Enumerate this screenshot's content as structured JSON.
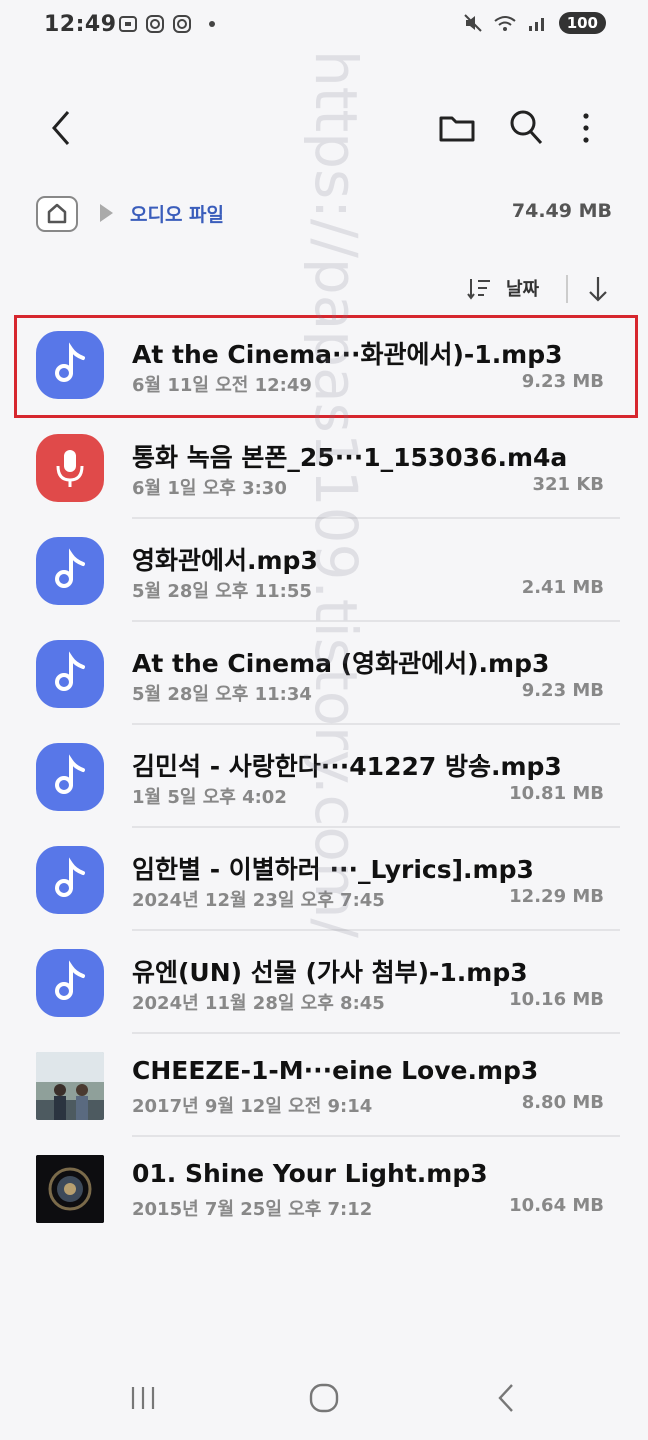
{
  "status": {
    "time": "12:49",
    "battery": "100",
    "network": "5"
  },
  "breadcrumb": {
    "folder": "오디오 파일",
    "total_size": "74.49 MB"
  },
  "sort": {
    "label": "날짜"
  },
  "files": [
    {
      "name": "At the Cinema···화관에서)-1.mp3",
      "date": "6월 11일 오전 12:49",
      "size": "9.23 MB",
      "icon": "music-note-icon",
      "selected": true
    },
    {
      "name": "통화 녹음 본폰_25···1_153036.m4a",
      "date": "6월 1일 오후 3:30",
      "size": "321 KB",
      "icon": "microphone-icon",
      "selected": false
    },
    {
      "name": "영화관에서.mp3",
      "date": "5월 28일 오후 11:55",
      "size": "2.41 MB",
      "icon": "music-note-icon",
      "selected": false
    },
    {
      "name": "At the Cinema (영화관에서).mp3",
      "date": "5월 28일 오후 11:34",
      "size": "9.23 MB",
      "icon": "music-note-icon",
      "selected": false
    },
    {
      "name": "김민석 - 사랑한다···41227 방송.mp3",
      "date": "1월 5일 오후 4:02",
      "size": "10.81 MB",
      "icon": "music-note-icon",
      "selected": false
    },
    {
      "name": "임한별 - 이별하러 ···_Lyrics].mp3",
      "date": "2024년 12월 23일 오후 7:45",
      "size": "12.29 MB",
      "icon": "music-note-icon",
      "selected": false
    },
    {
      "name": "유엔(UN)  선물 (가사 첨부)-1.mp3",
      "date": "2024년 11월 28일 오후 8:45",
      "size": "10.16 MB",
      "icon": "music-note-icon",
      "selected": false
    },
    {
      "name": "CHEEZE-1-M···eine Love.mp3",
      "date": "2017년 9월 12일 오전 9:14",
      "size": "8.80 MB",
      "icon": "album-photo-thumbnail",
      "selected": false
    },
    {
      "name": "01. Shine Your Light.mp3",
      "date": "2015년 7월 25일 오후 7:12",
      "size": "10.64 MB",
      "icon": "album-cover-thumbnail",
      "selected": false
    }
  ],
  "watermark": "https://papas1109.tistory.com/",
  "colors": {
    "audio_icon_bg": "#5877e8",
    "voice_icon_bg": "#e04a4a",
    "breadcrumb_accent": "#3a5dbb",
    "selection_border": "#d6262e"
  }
}
